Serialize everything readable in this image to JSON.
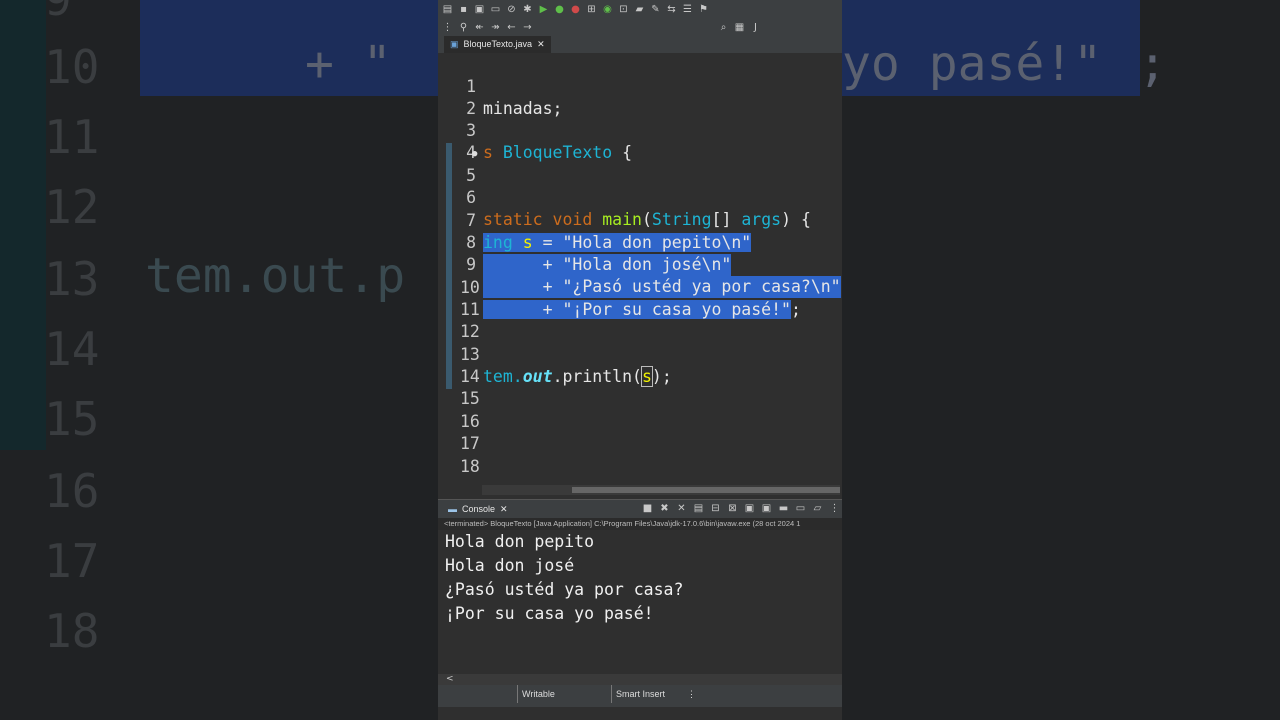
{
  "background": {
    "line_numbers": [
      "9",
      "10",
      "11",
      "12",
      "13",
      "14",
      "15",
      "16",
      "17",
      "18"
    ],
    "code_line_10_prefix": "+ \"",
    "code_line_10_suffix": "yo pasé!\"",
    "code_line_10_semicolon": ";",
    "code_line_13": "tem.out.p"
  },
  "editor_tab": {
    "title": "BloqueTexto.java",
    "close": "✕"
  },
  "editor": {
    "lines": [
      {
        "num": "1",
        "text": "minadas;"
      },
      {
        "num": "2",
        "text": ""
      },
      {
        "num": "3",
        "a": "s ",
        "b": "BloqueTexto",
        "c": " {"
      },
      {
        "num": "4",
        "text": ""
      },
      {
        "num": "5",
        "a": "static void ",
        "b": "main",
        "c": "(",
        "d": "String",
        "e": "[] ",
        "f": "args",
        "g": ") {"
      },
      {
        "num": "6",
        "text": ""
      },
      {
        "num": "7",
        "a": "ing ",
        "b": "s",
        "c": " = ",
        "d": "\"Hola don pepito\\n\""
      },
      {
        "num": "8",
        "text": "      + \"Hola don josé\\n\""
      },
      {
        "num": "9",
        "text": "      + \"¿Pasó ustéd ya por casa?\\n\""
      },
      {
        "num": "10",
        "a": "      + \"¡Por su casa yo pasé!\"",
        "b": ";"
      },
      {
        "num": "11",
        "text": ""
      },
      {
        "num": "12",
        "text": ""
      },
      {
        "num": "13",
        "a": "tem.",
        "b": "out",
        "c": ".println(",
        "d": "s",
        "e": ");"
      },
      {
        "num": "14",
        "text": ""
      },
      {
        "num": "15",
        "text": ""
      },
      {
        "num": "16",
        "text": ""
      },
      {
        "num": "17",
        "text": ""
      },
      {
        "num": "18",
        "text": ""
      }
    ]
  },
  "console": {
    "tab_label": "Console",
    "close": "✕",
    "info": "<terminated> BloqueTexto [Java Application] C:\\Program Files\\Java\\jdk-17.0.6\\bin\\javaw.exe  (28 oct 2024 1",
    "output": [
      "Hola don pepito",
      "Hola don josé",
      "¿Pasó ustéd ya por casa?",
      "¡Por su casa yo pasé!"
    ],
    "scroll_left": "<"
  },
  "statusbar": {
    "writable": "Writable",
    "insert_mode": "Smart Insert",
    "more": "⋮"
  },
  "colors": {
    "selection": "#2f65ca",
    "keyword": "#cc6c1d",
    "type": "#1eb4d4",
    "variable": "#f2f200",
    "field": "#66e1f8"
  }
}
